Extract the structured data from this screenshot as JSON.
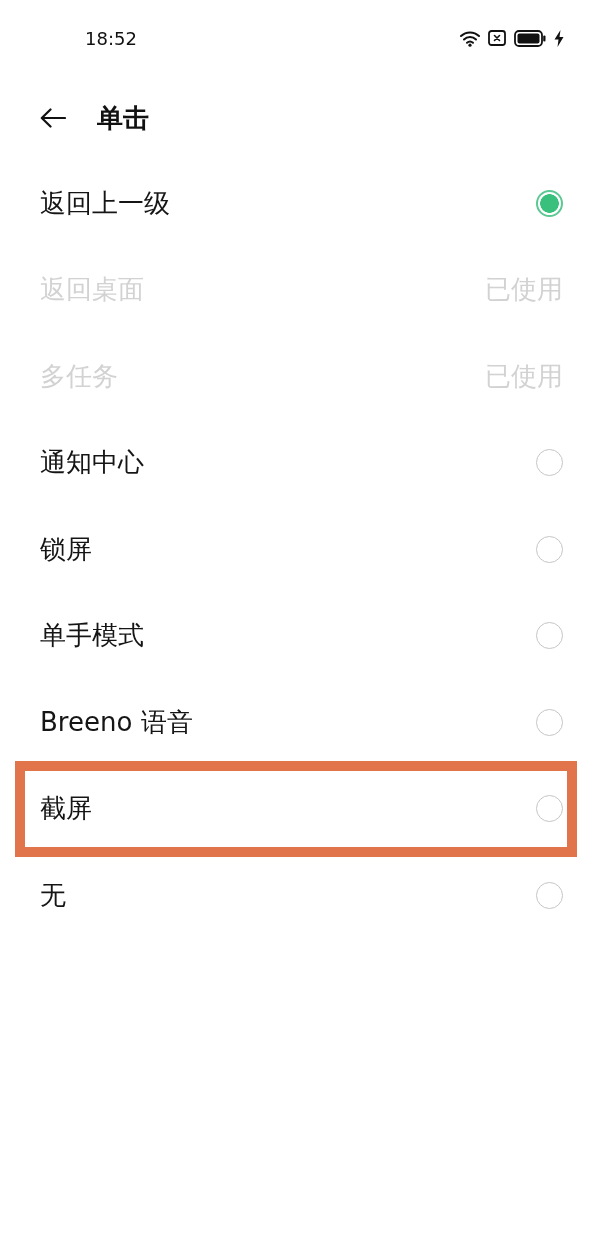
{
  "status_bar": {
    "time": "18:52"
  },
  "header": {
    "title": "单击"
  },
  "options": [
    {
      "label": "返回上一级",
      "selected": true,
      "disabled": false,
      "highlighted": false
    },
    {
      "label": "返回桌面",
      "disabled": true,
      "status": "已使用",
      "highlighted": false
    },
    {
      "label": "多任务",
      "disabled": true,
      "status": "已使用",
      "highlighted": false
    },
    {
      "label": "通知中心",
      "selected": false,
      "disabled": false,
      "highlighted": false
    },
    {
      "label": "锁屏",
      "selected": false,
      "disabled": false,
      "highlighted": false
    },
    {
      "label": "单手模式",
      "selected": false,
      "disabled": false,
      "highlighted": false
    },
    {
      "label": "Breeno 语音",
      "selected": false,
      "disabled": false,
      "highlighted": false
    },
    {
      "label": "截屏",
      "selected": false,
      "disabled": false,
      "highlighted": true
    },
    {
      "label": "无",
      "selected": false,
      "disabled": false,
      "highlighted": false
    }
  ]
}
